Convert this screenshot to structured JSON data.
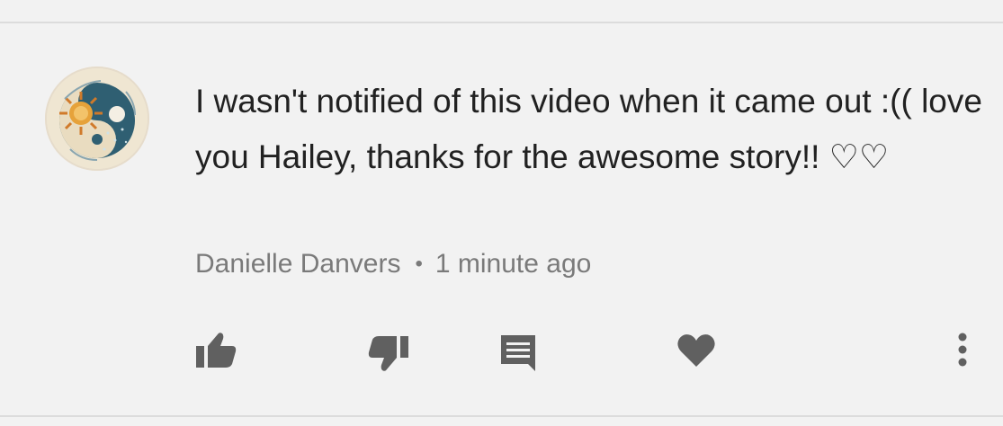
{
  "comment": {
    "text": "I wasn't notified of this video when it came out :(( love you Hailey, thanks for the awesome story!! ♡♡",
    "author": "Danielle Danvers",
    "separator": "•",
    "timestamp": "1 minute ago"
  },
  "avatar": {
    "description_icon": "sun-moon-yin-yang-icon"
  },
  "actions": [
    {
      "name": "like",
      "icon": "thumbs-up-icon"
    },
    {
      "name": "dislike",
      "icon": "thumbs-down-icon"
    },
    {
      "name": "reply",
      "icon": "comment-icon"
    },
    {
      "name": "heart",
      "icon": "heart-icon"
    },
    {
      "name": "more",
      "icon": "more-vertical-icon"
    }
  ],
  "colors": {
    "background": "#f2f2f2",
    "text": "#212121",
    "meta": "#7a7a7a",
    "icon": "#606060",
    "divider": "#dcdcdc"
  }
}
